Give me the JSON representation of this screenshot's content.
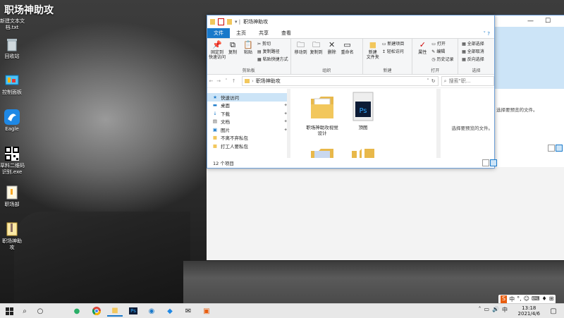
{
  "colors": {
    "accent": "#1979ca",
    "folder": "#f2c75c",
    "ps_blue": "#0d1c36",
    "ps_text": "#31a8ff"
  },
  "desktop": {
    "title": "职场神助攻",
    "icons": [
      {
        "label": "新建文本文\n档.txt",
        "icon": "text-file-icon"
      },
      {
        "label": "回收站",
        "icon": "recycle-bin-icon"
      },
      {
        "label": "控制面板",
        "icon": "control-panel-icon"
      },
      {
        "label": "Eagle",
        "icon": "eagle-icon"
      },
      {
        "label": "草料二维码\n识别.exe",
        "icon": "qr-code-icon"
      },
      {
        "label": "职场部",
        "icon": "file-icon"
      },
      {
        "label": "职场神助攻",
        "icon": "zip-icon"
      }
    ]
  },
  "explorer": {
    "title": "职场神助攻",
    "tabs": [
      "文件",
      "主页",
      "共享",
      "查看"
    ],
    "ribbon": {
      "clipboard": {
        "group": "剪贴板",
        "pin": "固定到\n快速访问",
        "copy": "复制",
        "paste": "粘贴",
        "cut": "剪切",
        "copy_path": "复制路径",
        "paste_shortcut": "粘贴快捷方式"
      },
      "organize": {
        "group": "组织",
        "move_to": "移动到",
        "copy_to": "复制到",
        "delete": "删除",
        "rename": "重命名"
      },
      "new": {
        "group": "新建",
        "new_folder": "新建\n文件夹",
        "new_item": "新建项目",
        "easy_access": "轻松访问"
      },
      "open": {
        "group": "打开",
        "properties": "属性",
        "open": "打开",
        "edit": "编辑",
        "history": "历史记录"
      },
      "select": {
        "group": "选择",
        "select_all": "全部选择",
        "select_none": "全部取消",
        "invert": "反向选择"
      }
    },
    "address": {
      "path": "职场神助攻",
      "search_placeholder": "搜索\"职..."
    },
    "nav": [
      {
        "label": "快速访问",
        "icon": "star-icon",
        "pinned": false
      },
      {
        "label": "桌面",
        "icon": "desktop-icon",
        "pinned": true
      },
      {
        "label": "下载",
        "icon": "download-icon",
        "pinned": true
      },
      {
        "label": "文档",
        "icon": "document-icon",
        "pinned": true
      },
      {
        "label": "图片",
        "icon": "picture-icon",
        "pinned": true
      },
      {
        "label": "不离不弃私包",
        "icon": "folder-icon",
        "pinned": false
      },
      {
        "label": "打工人要私包",
        "icon": "folder-icon",
        "pinned": false
      }
    ],
    "files": [
      {
        "name": "职场神助攻视觉\n设计",
        "type": "folder"
      },
      {
        "name": "顶图",
        "type": "psd"
      },
      {
        "name": "",
        "type": "folder"
      },
      {
        "name": "",
        "type": "folder"
      }
    ],
    "preview_text": "选择要预览的文件。",
    "status": "12 个项目"
  },
  "right_window": {
    "message": "选择要预览的文件。"
  },
  "taskbar": {
    "time": "13:18",
    "date": "2021/4/6",
    "apps": [
      "start-icon",
      "search-icon",
      "cortana-icon",
      "wechat-icon",
      "chrome-icon",
      "explorer-icon",
      "photoshop-icon",
      "edge-icon",
      "eagle-icon",
      "mail-icon",
      "app-icon"
    ],
    "ime": [
      "S",
      "中",
      "°,",
      "☺",
      "⌨",
      "♦",
      "⊞"
    ]
  }
}
